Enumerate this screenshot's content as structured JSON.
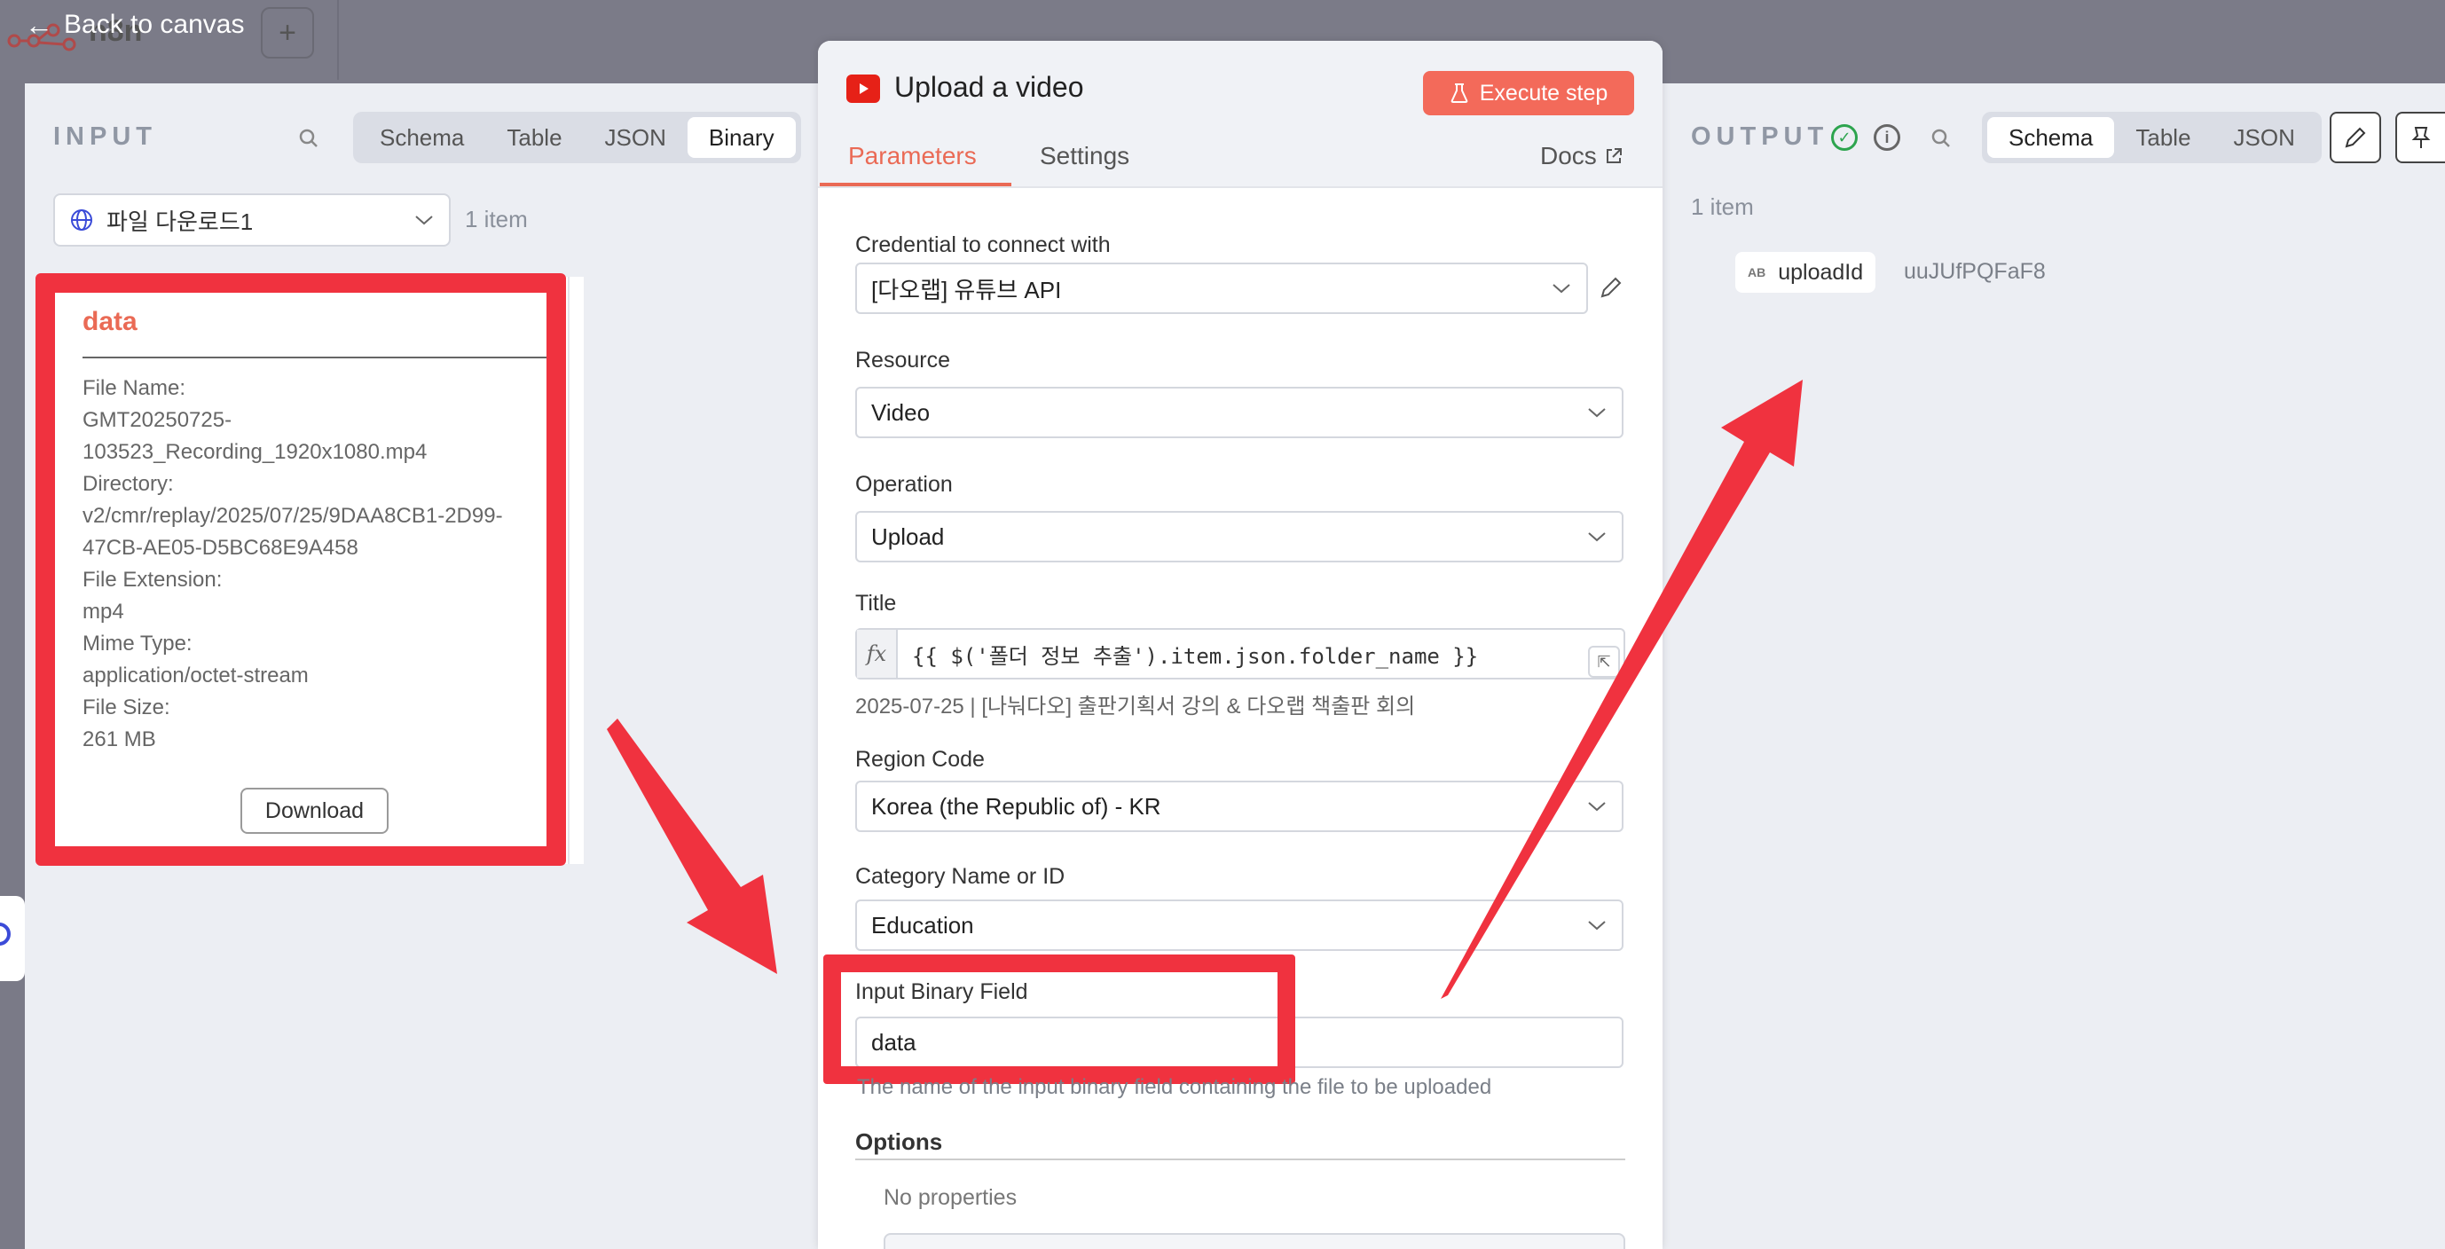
{
  "topbar": {
    "back_label": "Back to canvas",
    "workflow_logo_text": "n8n",
    "add_button": "+"
  },
  "input_panel": {
    "title": "INPUT",
    "tabs": [
      "Schema",
      "Table",
      "JSON",
      "Binary"
    ],
    "active_tab": "Binary",
    "node_select": "파일 다운로드1",
    "item_count": "1 item",
    "binary": {
      "name": "data",
      "file_name_label": "File Name:",
      "file_name": [
        "GMT20250725-",
        "103523_Recording_1920x1080.mp4"
      ],
      "directory_label": "Directory:",
      "directory": [
        "v2/cmr/replay/2025/07/25/9DAA8CB1-2D99-",
        "47CB-AE05-D5BC68E9A458"
      ],
      "extension_label": "File Extension:",
      "extension": "mp4",
      "mime_label": "Mime Type:",
      "mime": "application/octet-stream",
      "size_label": "File Size:",
      "size": "261 MB",
      "download_label": "Download"
    }
  },
  "node": {
    "title": "Upload a video",
    "execute_label": "Execute step",
    "tabs": {
      "parameters": "Parameters",
      "settings": "Settings",
      "docs": "Docs"
    },
    "fields": {
      "credential_label": "Credential to connect with",
      "credential_value": "[다오랩] 유튜브 API",
      "resource_label": "Resource",
      "resource_value": "Video",
      "operation_label": "Operation",
      "operation_value": "Upload",
      "title_label": "Title",
      "title_fx": "fx",
      "title_expression": "{{ $('폴더 정보 추출').item.json.folder_name }}",
      "title_preview": "2025-07-25 | [나눠다오] 출판기획서 강의 & 다오랩 책출판 회의",
      "region_label": "Region Code",
      "region_value": "Korea (the Republic of) - KR",
      "category_label": "Category Name or ID",
      "category_value": "Education",
      "binary_field_label": "Input Binary Field",
      "binary_field_value": "data",
      "binary_field_hint": "The name of the input binary field containing the file to be uploaded",
      "options_label": "Options",
      "no_properties": "No properties"
    }
  },
  "output_panel": {
    "title": "OUTPUT",
    "tabs": [
      "Schema",
      "Table",
      "JSON"
    ],
    "active_tab": "Schema",
    "item_count": "1 item",
    "schema": {
      "type_badge": "AB",
      "key": "uploadId",
      "value": "uuJUfPQFaF8"
    }
  },
  "colors": {
    "accent": "#ea6a55",
    "execute_button": "#f36a5a",
    "annotation_red": "#f0323f",
    "success_green": "#2da44e",
    "youtube_red": "#e62117"
  }
}
